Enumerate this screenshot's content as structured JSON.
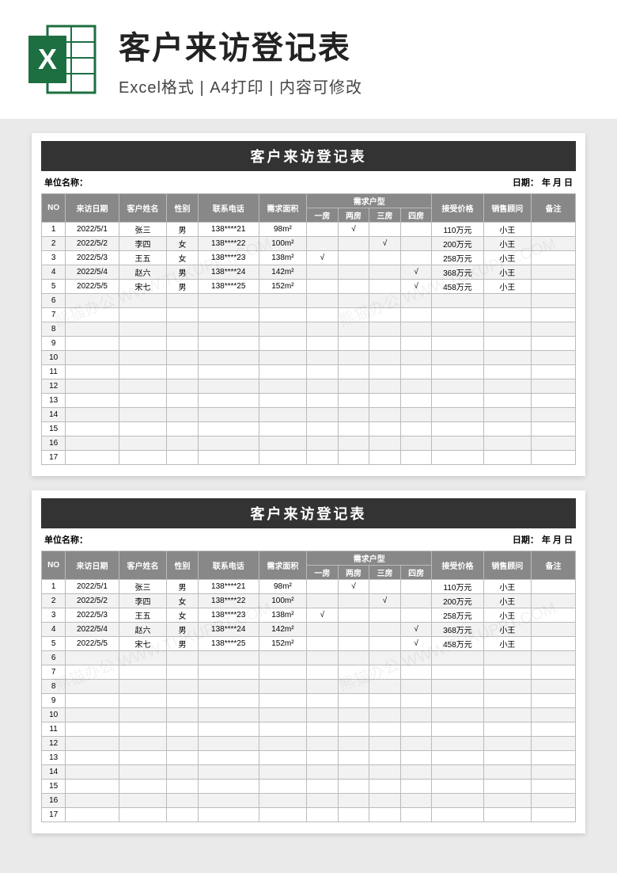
{
  "banner": {
    "title": "客户来访登记表",
    "subtitle": "Excel格式 | A4打印 | 内容可修改"
  },
  "sheet": {
    "title": "客户来访登记表",
    "unit_label": "单位名称：",
    "date_label": "日期：",
    "date_suffix": "年  月  日",
    "headers": {
      "no": "NO",
      "visit_date": "来访日期",
      "name": "客户姓名",
      "gender": "性别",
      "phone": "联系电话",
      "area": "需求面积",
      "room_group": "需求户型",
      "room1": "一房",
      "room2": "两房",
      "room3": "三房",
      "room4": "四房",
      "price": "接受价格",
      "sales": "销售顾问",
      "note": "备注"
    },
    "rows": [
      {
        "no": "1",
        "date": "2022/5/1",
        "name": "张三",
        "gender": "男",
        "phone": "138****21",
        "area": "98m²",
        "r1": "",
        "r2": "√",
        "r3": "",
        "r4": "",
        "price": "110万元",
        "sales": "小王",
        "note": ""
      },
      {
        "no": "2",
        "date": "2022/5/2",
        "name": "李四",
        "gender": "女",
        "phone": "138****22",
        "area": "100m²",
        "r1": "",
        "r2": "",
        "r3": "√",
        "r4": "",
        "price": "200万元",
        "sales": "小王",
        "note": ""
      },
      {
        "no": "3",
        "date": "2022/5/3",
        "name": "王五",
        "gender": "女",
        "phone": "138****23",
        "area": "138m²",
        "r1": "√",
        "r2": "",
        "r3": "",
        "r4": "",
        "price": "258万元",
        "sales": "小王",
        "note": ""
      },
      {
        "no": "4",
        "date": "2022/5/4",
        "name": "赵六",
        "gender": "男",
        "phone": "138****24",
        "area": "142m²",
        "r1": "",
        "r2": "",
        "r3": "",
        "r4": "√",
        "price": "368万元",
        "sales": "小王",
        "note": ""
      },
      {
        "no": "5",
        "date": "2022/5/5",
        "name": "宋七",
        "gender": "男",
        "phone": "138****25",
        "area": "152m²",
        "r1": "",
        "r2": "",
        "r3": "",
        "r4": "√",
        "price": "458万元",
        "sales": "小王",
        "note": ""
      },
      {
        "no": "6"
      },
      {
        "no": "7"
      },
      {
        "no": "8"
      },
      {
        "no": "9"
      },
      {
        "no": "10"
      },
      {
        "no": "11"
      },
      {
        "no": "12"
      },
      {
        "no": "13"
      },
      {
        "no": "14"
      },
      {
        "no": "15"
      },
      {
        "no": "16"
      },
      {
        "no": "17"
      }
    ]
  },
  "watermark": "熊猫办公 WWW.TUKUPPT.COM"
}
